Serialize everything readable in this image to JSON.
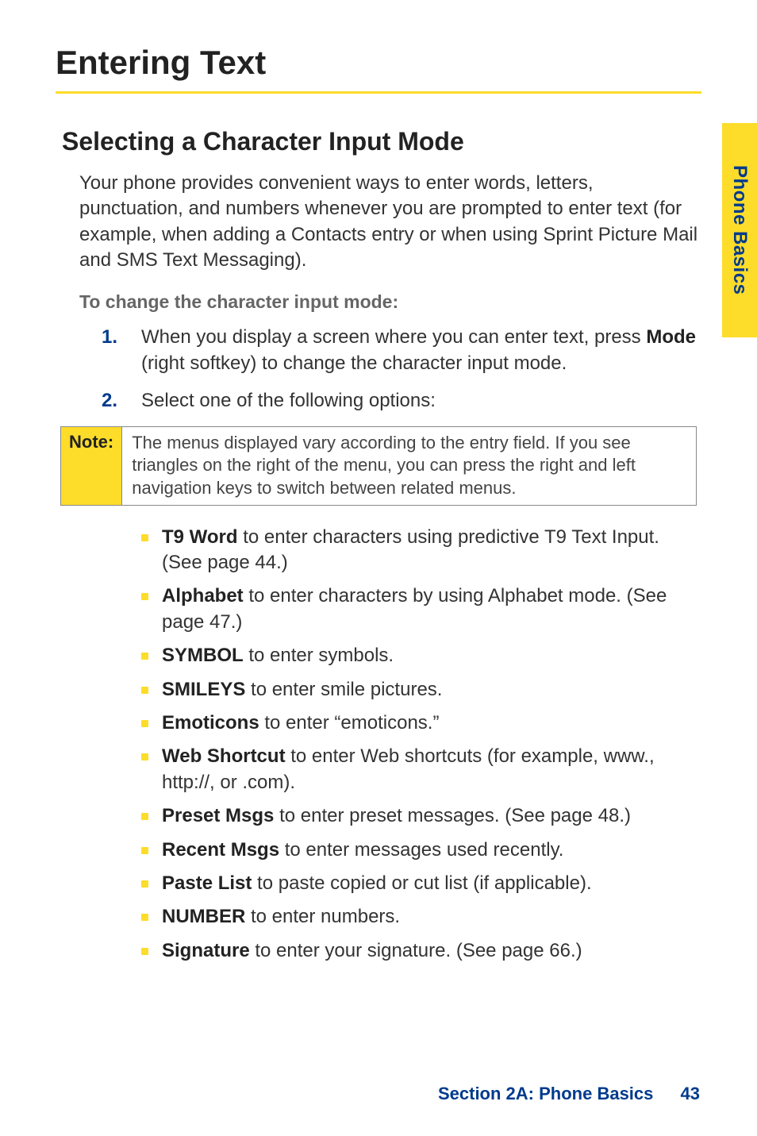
{
  "sideTab": "Phone Basics",
  "title": "Entering Text",
  "subtitle": "Selecting a Character Input Mode",
  "intro": "Your phone provides convenient ways to enter words, letters, punctuation, and numbers whenever you are prompted to enter text (for example, when adding a Contacts entry or when using Sprint Picture Mail and SMS Text Messaging).",
  "subHeading": "To change the character input mode:",
  "steps": [
    {
      "num": "1.",
      "before": "When you display a screen where you can enter text, press ",
      "bold": "Mode",
      "after": " (right softkey) to change the character input mode."
    },
    {
      "num": "2.",
      "before": "Select one of the following options:",
      "bold": "",
      "after": ""
    }
  ],
  "note": {
    "label": "Note:",
    "body": "The menus displayed vary according to the entry field. If you see triangles on the right of the menu, you can press the right and left navigation keys to switch between related menus."
  },
  "bullets": [
    {
      "label": "T9 Word",
      "text": " to enter characters using predictive T9 Text Input. (See page 44.)"
    },
    {
      "label": "Alphabet",
      "text": " to enter characters by using Alphabet mode. (See page 47.)"
    },
    {
      "label": "SYMBOL",
      "text": " to enter symbols."
    },
    {
      "label": "SMILEYS",
      "text": " to enter smile pictures."
    },
    {
      "label": "Emoticons",
      "text": " to enter “emoticons.”"
    },
    {
      "label": "Web Shortcut",
      "text": " to enter Web shortcuts (for example, www., http://, or .com)."
    },
    {
      "label": "Preset Msgs",
      "text": " to enter preset messages. (See page 48.)"
    },
    {
      "label": "Recent Msgs",
      "text": " to enter messages used recently."
    },
    {
      "label": "Paste List",
      "text": " to paste copied or cut list (if applicable)."
    },
    {
      "label": "NUMBER",
      "text": " to enter numbers."
    },
    {
      "label": "Signature",
      "text": " to enter your signature. (See page 66.)"
    }
  ],
  "footer": {
    "section": "Section 2A: Phone Basics",
    "page": "43"
  }
}
